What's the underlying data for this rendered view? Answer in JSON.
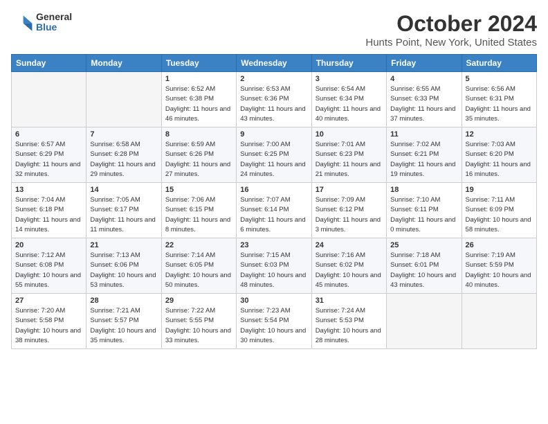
{
  "header": {
    "logo_general": "General",
    "logo_blue": "Blue",
    "month_title": "October 2024",
    "location": "Hunts Point, New York, United States"
  },
  "days_of_week": [
    "Sunday",
    "Monday",
    "Tuesday",
    "Wednesday",
    "Thursday",
    "Friday",
    "Saturday"
  ],
  "weeks": [
    [
      {
        "day": "",
        "sunrise": "",
        "sunset": "",
        "daylight": ""
      },
      {
        "day": "",
        "sunrise": "",
        "sunset": "",
        "daylight": ""
      },
      {
        "day": "1",
        "sunrise": "Sunrise: 6:52 AM",
        "sunset": "Sunset: 6:38 PM",
        "daylight": "Daylight: 11 hours and 46 minutes."
      },
      {
        "day": "2",
        "sunrise": "Sunrise: 6:53 AM",
        "sunset": "Sunset: 6:36 PM",
        "daylight": "Daylight: 11 hours and 43 minutes."
      },
      {
        "day": "3",
        "sunrise": "Sunrise: 6:54 AM",
        "sunset": "Sunset: 6:34 PM",
        "daylight": "Daylight: 11 hours and 40 minutes."
      },
      {
        "day": "4",
        "sunrise": "Sunrise: 6:55 AM",
        "sunset": "Sunset: 6:33 PM",
        "daylight": "Daylight: 11 hours and 37 minutes."
      },
      {
        "day": "5",
        "sunrise": "Sunrise: 6:56 AM",
        "sunset": "Sunset: 6:31 PM",
        "daylight": "Daylight: 11 hours and 35 minutes."
      }
    ],
    [
      {
        "day": "6",
        "sunrise": "Sunrise: 6:57 AM",
        "sunset": "Sunset: 6:29 PM",
        "daylight": "Daylight: 11 hours and 32 minutes."
      },
      {
        "day": "7",
        "sunrise": "Sunrise: 6:58 AM",
        "sunset": "Sunset: 6:28 PM",
        "daylight": "Daylight: 11 hours and 29 minutes."
      },
      {
        "day": "8",
        "sunrise": "Sunrise: 6:59 AM",
        "sunset": "Sunset: 6:26 PM",
        "daylight": "Daylight: 11 hours and 27 minutes."
      },
      {
        "day": "9",
        "sunrise": "Sunrise: 7:00 AM",
        "sunset": "Sunset: 6:25 PM",
        "daylight": "Daylight: 11 hours and 24 minutes."
      },
      {
        "day": "10",
        "sunrise": "Sunrise: 7:01 AM",
        "sunset": "Sunset: 6:23 PM",
        "daylight": "Daylight: 11 hours and 21 minutes."
      },
      {
        "day": "11",
        "sunrise": "Sunrise: 7:02 AM",
        "sunset": "Sunset: 6:21 PM",
        "daylight": "Daylight: 11 hours and 19 minutes."
      },
      {
        "day": "12",
        "sunrise": "Sunrise: 7:03 AM",
        "sunset": "Sunset: 6:20 PM",
        "daylight": "Daylight: 11 hours and 16 minutes."
      }
    ],
    [
      {
        "day": "13",
        "sunrise": "Sunrise: 7:04 AM",
        "sunset": "Sunset: 6:18 PM",
        "daylight": "Daylight: 11 hours and 14 minutes."
      },
      {
        "day": "14",
        "sunrise": "Sunrise: 7:05 AM",
        "sunset": "Sunset: 6:17 PM",
        "daylight": "Daylight: 11 hours and 11 minutes."
      },
      {
        "day": "15",
        "sunrise": "Sunrise: 7:06 AM",
        "sunset": "Sunset: 6:15 PM",
        "daylight": "Daylight: 11 hours and 8 minutes."
      },
      {
        "day": "16",
        "sunrise": "Sunrise: 7:07 AM",
        "sunset": "Sunset: 6:14 PM",
        "daylight": "Daylight: 11 hours and 6 minutes."
      },
      {
        "day": "17",
        "sunrise": "Sunrise: 7:09 AM",
        "sunset": "Sunset: 6:12 PM",
        "daylight": "Daylight: 11 hours and 3 minutes."
      },
      {
        "day": "18",
        "sunrise": "Sunrise: 7:10 AM",
        "sunset": "Sunset: 6:11 PM",
        "daylight": "Daylight: 11 hours and 0 minutes."
      },
      {
        "day": "19",
        "sunrise": "Sunrise: 7:11 AM",
        "sunset": "Sunset: 6:09 PM",
        "daylight": "Daylight: 10 hours and 58 minutes."
      }
    ],
    [
      {
        "day": "20",
        "sunrise": "Sunrise: 7:12 AM",
        "sunset": "Sunset: 6:08 PM",
        "daylight": "Daylight: 10 hours and 55 minutes."
      },
      {
        "day": "21",
        "sunrise": "Sunrise: 7:13 AM",
        "sunset": "Sunset: 6:06 PM",
        "daylight": "Daylight: 10 hours and 53 minutes."
      },
      {
        "day": "22",
        "sunrise": "Sunrise: 7:14 AM",
        "sunset": "Sunset: 6:05 PM",
        "daylight": "Daylight: 10 hours and 50 minutes."
      },
      {
        "day": "23",
        "sunrise": "Sunrise: 7:15 AM",
        "sunset": "Sunset: 6:03 PM",
        "daylight": "Daylight: 10 hours and 48 minutes."
      },
      {
        "day": "24",
        "sunrise": "Sunrise: 7:16 AM",
        "sunset": "Sunset: 6:02 PM",
        "daylight": "Daylight: 10 hours and 45 minutes."
      },
      {
        "day": "25",
        "sunrise": "Sunrise: 7:18 AM",
        "sunset": "Sunset: 6:01 PM",
        "daylight": "Daylight: 10 hours and 43 minutes."
      },
      {
        "day": "26",
        "sunrise": "Sunrise: 7:19 AM",
        "sunset": "Sunset: 5:59 PM",
        "daylight": "Daylight: 10 hours and 40 minutes."
      }
    ],
    [
      {
        "day": "27",
        "sunrise": "Sunrise: 7:20 AM",
        "sunset": "Sunset: 5:58 PM",
        "daylight": "Daylight: 10 hours and 38 minutes."
      },
      {
        "day": "28",
        "sunrise": "Sunrise: 7:21 AM",
        "sunset": "Sunset: 5:57 PM",
        "daylight": "Daylight: 10 hours and 35 minutes."
      },
      {
        "day": "29",
        "sunrise": "Sunrise: 7:22 AM",
        "sunset": "Sunset: 5:55 PM",
        "daylight": "Daylight: 10 hours and 33 minutes."
      },
      {
        "day": "30",
        "sunrise": "Sunrise: 7:23 AM",
        "sunset": "Sunset: 5:54 PM",
        "daylight": "Daylight: 10 hours and 30 minutes."
      },
      {
        "day": "31",
        "sunrise": "Sunrise: 7:24 AM",
        "sunset": "Sunset: 5:53 PM",
        "daylight": "Daylight: 10 hours and 28 minutes."
      },
      {
        "day": "",
        "sunrise": "",
        "sunset": "",
        "daylight": ""
      },
      {
        "day": "",
        "sunrise": "",
        "sunset": "",
        "daylight": ""
      }
    ]
  ]
}
